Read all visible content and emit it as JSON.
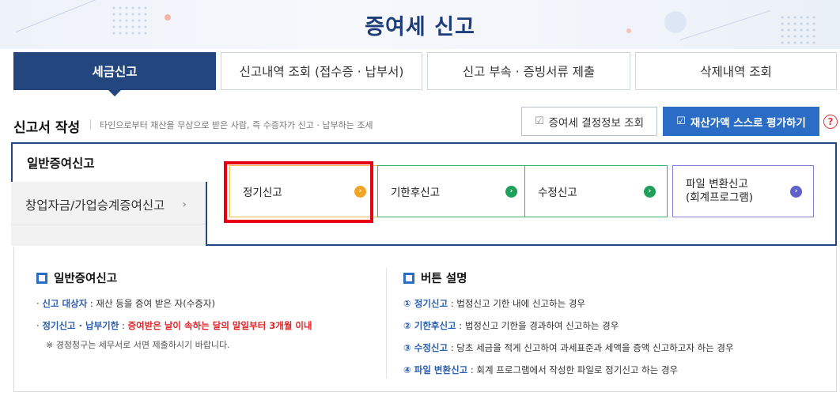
{
  "page_title": "증여세 신고",
  "tabs": [
    {
      "label": "세금신고",
      "active": true
    },
    {
      "label": "신고내역 조회 (접수증 · 납부서)",
      "active": false
    },
    {
      "label": "신고 부속 · 증빙서류 제출",
      "active": false
    },
    {
      "label": "삭제내역 조회",
      "active": false
    }
  ],
  "section": {
    "title": "신고서 작성",
    "description": "타인으로부터 재산을 무상으로 받은 사람, 즉 수증자가 신고 · 납부하는 조세",
    "lookup_button": "증여세 결정정보 조회",
    "self_eval_button": "재산가액 스스로 평가하기",
    "help": "?"
  },
  "report_types": [
    {
      "label": "일반증여신고",
      "active": true
    },
    {
      "label": "창업자금/가업승계증여신고",
      "chevron": "›",
      "active": false
    }
  ],
  "options": [
    {
      "label": "정기신고",
      "color": "#f0a524"
    },
    {
      "label": "기한후신고",
      "color": "#1fa05a"
    },
    {
      "label": "수정신고",
      "color": "#1fa05a"
    },
    {
      "label_line1": "파일 변환신고",
      "label_line2": "(회계프로그램)",
      "color": "#5d61c9"
    }
  ],
  "info_left": {
    "heading": "일반증여신고",
    "target_key": "신고 대상자",
    "target_value": " : 재산 등을 증여 받은 자(수증자)",
    "deadline_key": "정기신고 · 납부기한",
    "deadline_value": "증여받은 날이 속하는 달의 말일부터 3개월 이내",
    "note": "※ 경정청구는 세무서로 서면 제출하시기 바랍니다."
  },
  "info_right": {
    "heading": "버튼 설명",
    "items": [
      {
        "key": "① 정기신고",
        "text": " : 법정신고 기한 내에 신고하는 경우"
      },
      {
        "key": "② 기한후신고",
        "text": " : 법정신고 기한을 경과하여 신고하는 경우"
      },
      {
        "key": "③ 수정신고",
        "text": " : 당초 세금을 적게 신고하여 과세표준과 세액을 증액 신고하고자 하는 경우"
      },
      {
        "key": "④ 파일 변환신고",
        "text": " : 회계 프로그램에서 작성한 파일로 정기신고 하는 경우"
      }
    ]
  },
  "icons": {
    "checkbox-icon": "☑",
    "arrow-icon": "›",
    "square-bullet-icon": "□"
  },
  "colors": {
    "brand_navy": "#23467e",
    "accent_blue": "#2b6cc4",
    "highlight_red": "#e60012",
    "warning_red": "#e0262b"
  }
}
